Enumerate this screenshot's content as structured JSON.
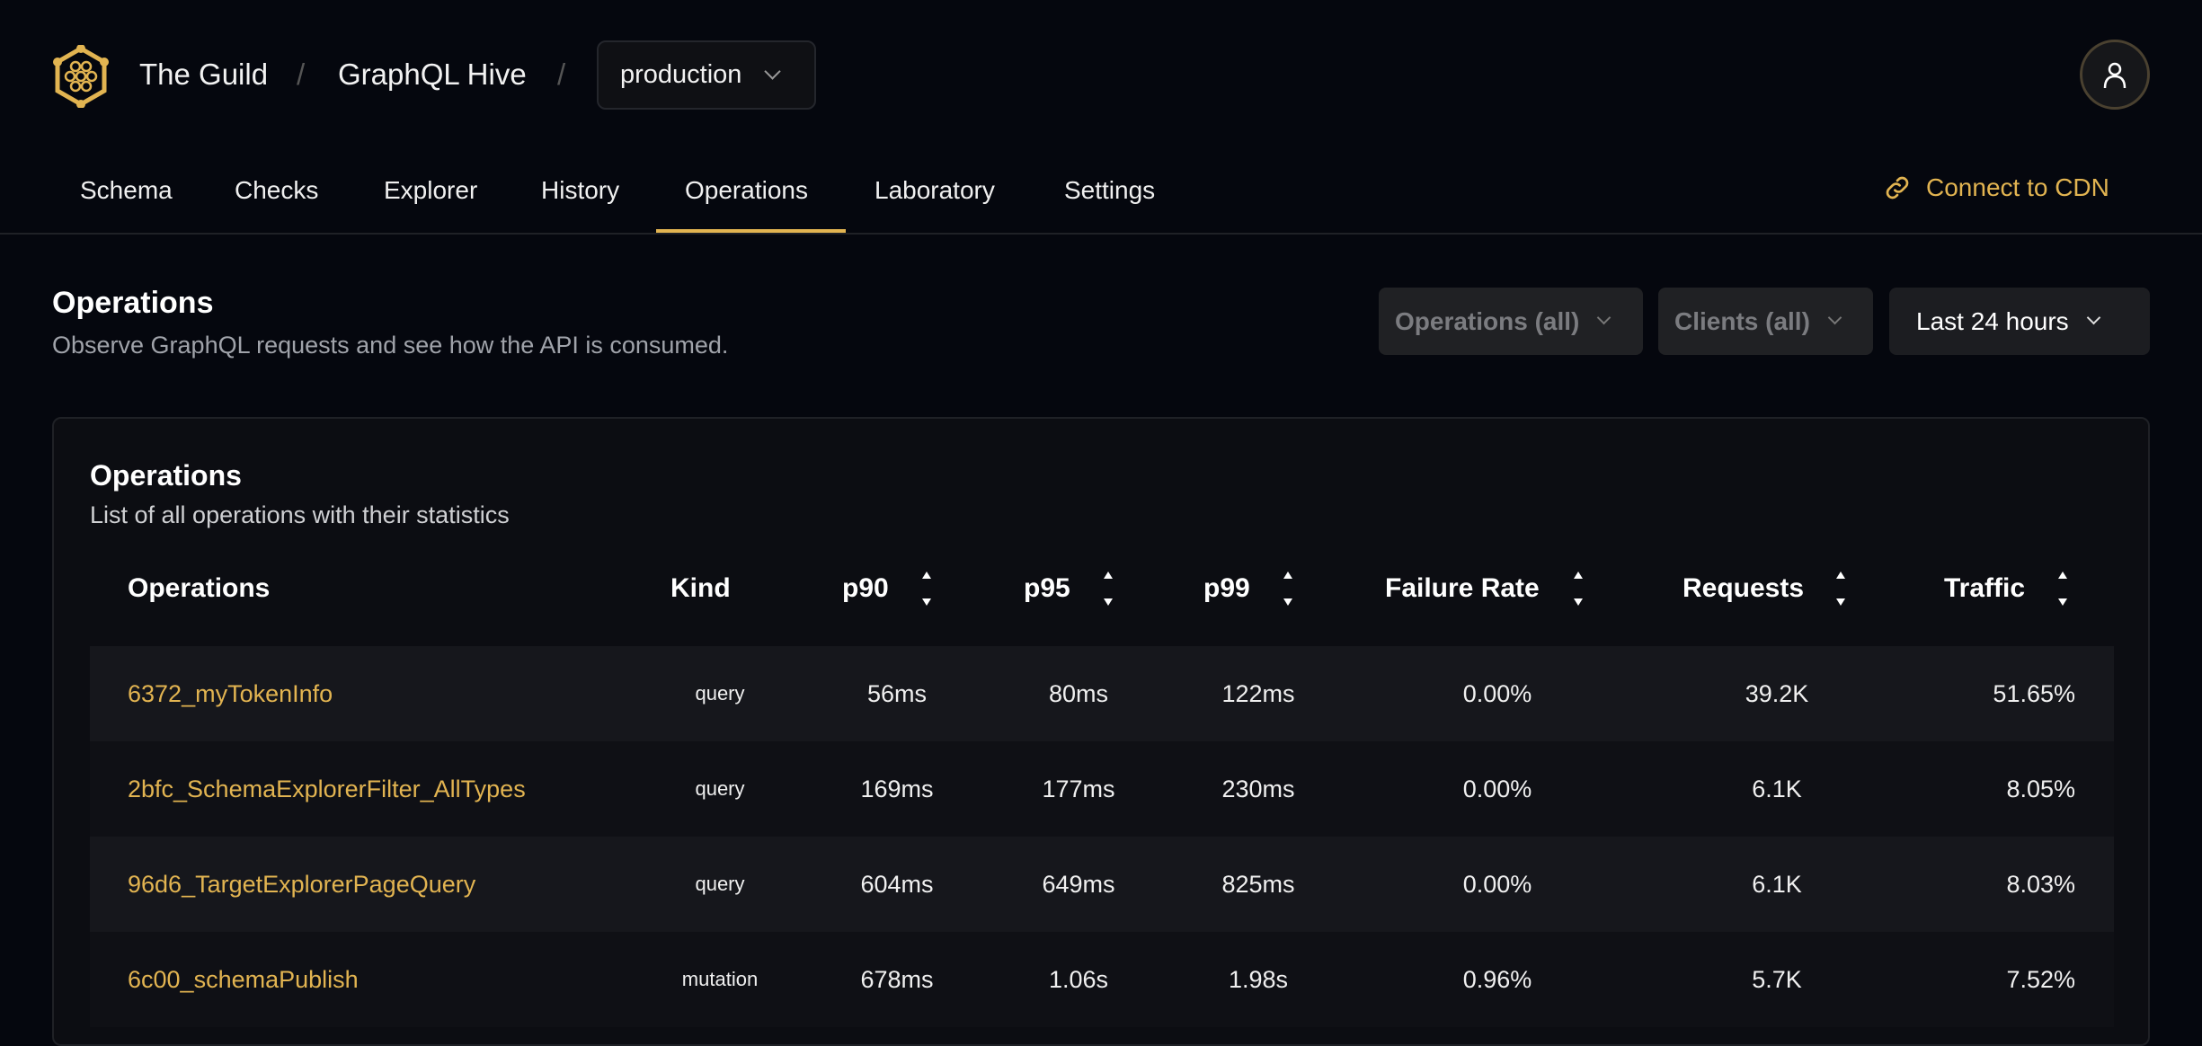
{
  "header": {
    "org": "The Guild",
    "project": "GraphQL Hive",
    "target": "production",
    "separator": "/"
  },
  "tabs": [
    {
      "label": "Schema"
    },
    {
      "label": "Checks"
    },
    {
      "label": "Explorer"
    },
    {
      "label": "History"
    },
    {
      "label": "Operations",
      "active": true
    },
    {
      "label": "Laboratory"
    },
    {
      "label": "Settings"
    }
  ],
  "cdn_label": "Connect to CDN",
  "accent": "#e2b451",
  "page": {
    "title": "Operations",
    "subtitle": "Observe GraphQL requests and see how the API is consumed."
  },
  "filters": {
    "operations": "Operations (all)",
    "clients": "Clients (all)",
    "period": "Last 24 hours"
  },
  "card": {
    "title": "Operations",
    "subtitle": "List of all operations with their statistics"
  },
  "table": {
    "columns": [
      "Operations",
      "Kind",
      "p90",
      "p95",
      "p99",
      "Failure Rate",
      "Requests",
      "Traffic"
    ],
    "rows": [
      [
        "6372_myTokenInfo",
        "query",
        "56ms",
        "80ms",
        "122ms",
        "0.00%",
        "39.2K",
        "51.65%"
      ],
      [
        "2bfc_SchemaExplorerFilter_AllTypes",
        "query",
        "169ms",
        "177ms",
        "230ms",
        "0.00%",
        "6.1K",
        "8.05%"
      ],
      [
        "96d6_TargetExplorerPageQuery",
        "query",
        "604ms",
        "649ms",
        "825ms",
        "0.00%",
        "6.1K",
        "8.03%"
      ],
      [
        "6c00_schemaPublish",
        "mutation",
        "678ms",
        "1.06s",
        "1.98s",
        "0.96%",
        "5.7K",
        "7.52%"
      ]
    ]
  }
}
